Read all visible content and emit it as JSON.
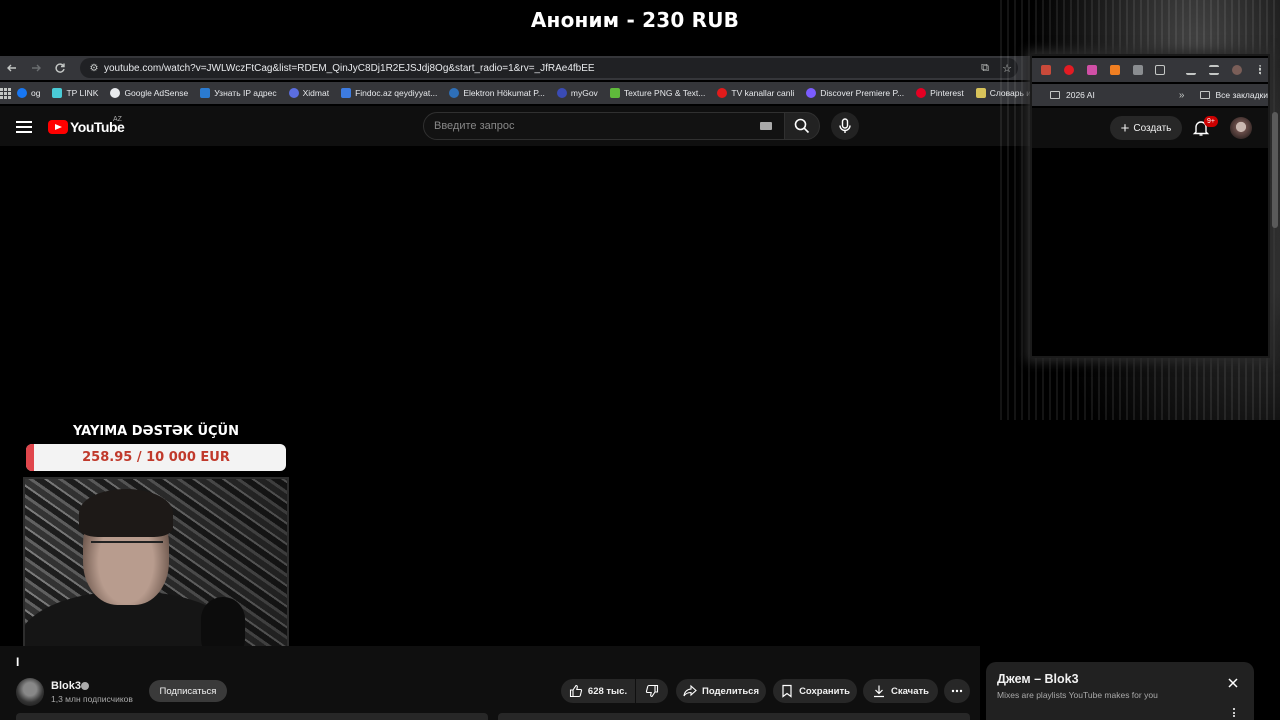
{
  "overlay": {
    "donation_title": "Аноним - 230 RUB",
    "goal_title": "YAYIMA DƏSTƏK ÜÇÜN",
    "goal_text": "258.95 / 10 000 EUR",
    "goal_fraction": 0.026,
    "goal_fill_color": "#e0454b"
  },
  "browser": {
    "url": "youtube.com/watch?v=JWLWczFtCag&list=RDEM_QinJyC8Dj1R2EJSJdj8Og&start_radio=1&rv=_JfRAe4fbEE",
    "bookmarks": [
      {
        "label": "og",
        "icon": "facebook-icon",
        "color": "#1877f2"
      },
      {
        "label": "TP LINK",
        "icon": "tplink-icon",
        "color": "#4acbd6"
      },
      {
        "label": "Google AdSense",
        "icon": "google-icon",
        "color": "#e8eaed"
      },
      {
        "label": "Узнать IP адрес",
        "icon": "ip-icon",
        "color": "#2b7bd1"
      },
      {
        "label": "Xidmat",
        "icon": "globe-icon",
        "color": "#5b6ee1"
      },
      {
        "label": "Findoc.az qeydiyyat...",
        "icon": "findoc-icon",
        "color": "#3d7be0"
      },
      {
        "label": "Elektron Hökumat P...",
        "icon": "gov-icon",
        "color": "#2e6fb8"
      },
      {
        "label": "myGov",
        "icon": "mygov-icon",
        "color": "#3a4bb5"
      },
      {
        "label": "Texture PNG & Text...",
        "icon": "leaf-icon",
        "color": "#5fba3b"
      },
      {
        "label": "TV kanallar canli",
        "icon": "tv-icon",
        "color": "#e21b1b"
      },
      {
        "label": "Discover Premiere P...",
        "icon": "premiere-icon",
        "color": "#7b5cff"
      },
      {
        "label": "Pinterest",
        "icon": "pinterest-icon",
        "color": "#e60023"
      },
      {
        "label": "Словарь игровых т...",
        "icon": "shield-icon",
        "color": "#d8c35a"
      }
    ],
    "right_bookmark_folder": "2026 AI",
    "all_bookmarks": "Все закладки"
  },
  "youtube": {
    "logo": "YouTube",
    "country": "AZ",
    "search_placeholder": "Введите запрос",
    "create_label": "Создать",
    "notifications_badge": "9+",
    "channel": {
      "title_initial": "I",
      "name": "Blok3",
      "subscribers": "1,3 млн подписчиков",
      "subscribe_label": "Подписаться"
    },
    "actions": {
      "likes": "628 тыс.",
      "share": "Поделиться",
      "save": "Сохранить",
      "download": "Скачать"
    },
    "mix": {
      "title": "Джем – Blok3",
      "subtitle": "Mixes are playlists YouTube makes for you"
    }
  }
}
